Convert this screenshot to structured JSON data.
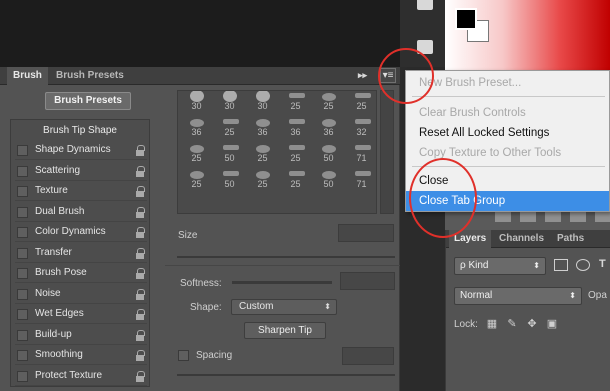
{
  "app": {
    "annotation_color": "#e0302a",
    "menu_highlight_color": "#3d8ee6"
  },
  "brush_panel": {
    "tabs": [
      "Brush",
      "Brush Presets"
    ],
    "collapse_glyph": "▸▸",
    "menu_glyph": "▾≡",
    "presets_button": "Brush Presets",
    "options_header": "Brush Tip Shape",
    "options": [
      "Shape Dynamics",
      "Scattering",
      "Texture",
      "Dual Brush",
      "Color Dynamics",
      "Transfer",
      "Brush Pose",
      "Noise",
      "Wet Edges",
      "Build-up",
      "Smoothing",
      "Protect Texture"
    ],
    "tip_sizes": [
      "30",
      "30",
      "30",
      "25",
      "25",
      "25",
      "36",
      "25",
      "36",
      "36",
      "36",
      "32",
      "25",
      "50",
      "25",
      "25",
      "50",
      "71",
      "25",
      "50",
      "25",
      "25",
      "50",
      "71"
    ],
    "size_label": "Size",
    "softness_label": "Softness:",
    "shape_label": "Shape:",
    "shape_value": "Custom",
    "sharpen_button": "Sharpen Tip",
    "spacing_label": "Spacing"
  },
  "context_menu": {
    "items": [
      {
        "label": "New Brush Preset...",
        "state": "disabled"
      },
      {
        "label": "Clear Brush Controls",
        "state": "disabled"
      },
      {
        "label": "Reset All Locked Settings",
        "state": "enabled"
      },
      {
        "label": "Copy Texture to Other Tools",
        "state": "disabled"
      },
      {
        "label": "Close",
        "state": "enabled"
      },
      {
        "label": "Close Tab Group",
        "state": "selected"
      }
    ]
  },
  "layers_panel": {
    "tabs": [
      "Layers",
      "Channels",
      "Paths"
    ],
    "kind_select": "ρ Kind",
    "blend_mode": "Normal",
    "opacity_label": "Opa",
    "lock_label": "Lock:"
  }
}
